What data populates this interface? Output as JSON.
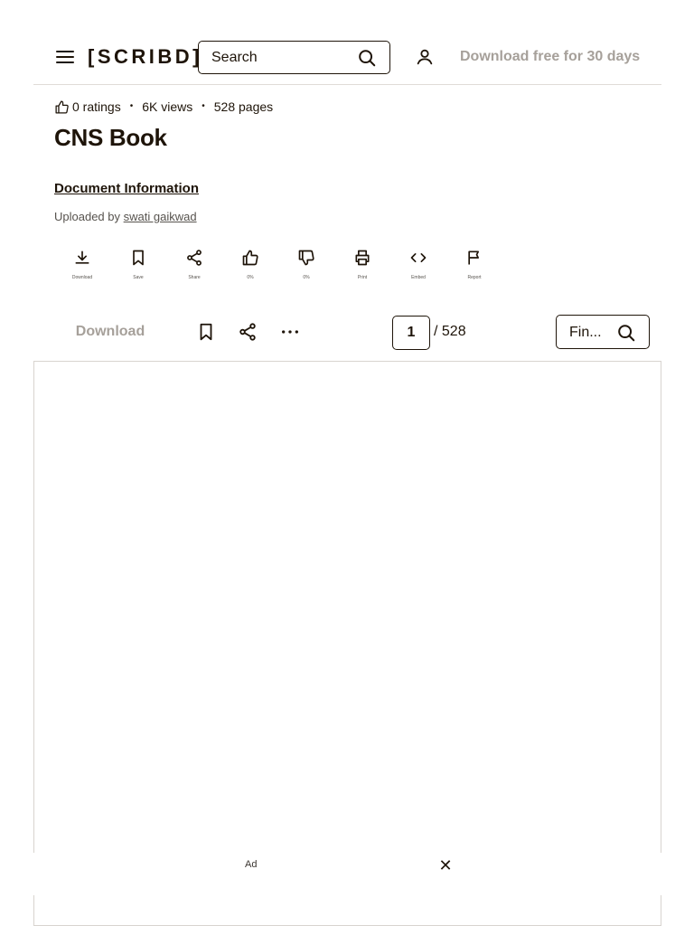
{
  "header": {
    "logo": "[SCRIBD]",
    "search_placeholder": "Search",
    "cta": "Download free for 30 days"
  },
  "document": {
    "ratings": "0 ratings",
    "views": "6K views",
    "pages": "528 pages",
    "title": "CNS Book",
    "info_link": "Document Information",
    "uploaded_by_label": "Uploaded by",
    "uploader": "swati gaikwad"
  },
  "actions": [
    {
      "label": "Download",
      "icon": "download-icon"
    },
    {
      "label": "Save",
      "icon": "bookmark-icon"
    },
    {
      "label": "Share",
      "icon": "share-icon"
    },
    {
      "label": "0%",
      "icon": "thumbs-up-icon"
    },
    {
      "label": "0%",
      "icon": "thumbs-down-icon"
    },
    {
      "label": "Print",
      "icon": "print-icon"
    },
    {
      "label": "Embed",
      "icon": "embed-icon"
    },
    {
      "label": "Report",
      "icon": "flag-icon"
    }
  ],
  "toolbar": {
    "download_label": "Download",
    "current_page": "1",
    "total_pages": "/ 528",
    "find_label": "Fin..."
  },
  "ad": {
    "label": "Ad",
    "close_glyph": "✕"
  },
  "colors": {
    "text": "#1e1409",
    "muted": "#a6a09a",
    "border": "#d8d4cf"
  }
}
